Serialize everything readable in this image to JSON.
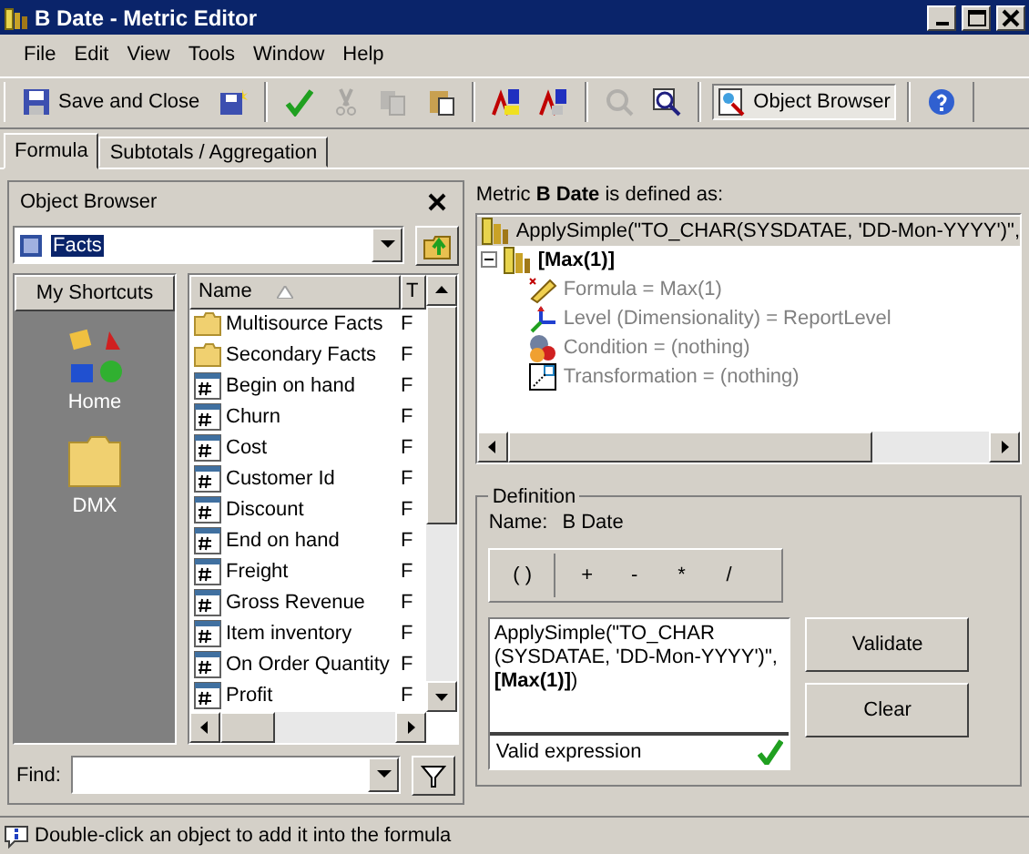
{
  "window": {
    "title": "B Date - Metric Editor"
  },
  "menu": [
    "File",
    "Edit",
    "View",
    "Tools",
    "Window",
    "Help"
  ],
  "toolbar": [
    [
      {
        "label": "Save and Close",
        "disabled": false
      },
      {
        "disabled": false
      }
    ],
    [
      {
        "disabled": false
      },
      {
        "disabled": true
      },
      {
        "disabled": true
      },
      {
        "disabled": false
      }
    ],
    [
      {
        "disabled": false
      },
      {
        "disabled": false
      }
    ],
    [
      {
        "disabled": true
      },
      {
        "disabled": false
      }
    ],
    [
      {
        "label": "Object Browser",
        "disabled": false,
        "pressed": true
      }
    ],
    [
      {
        "disabled": false
      }
    ]
  ],
  "tabs": [
    {
      "label": "Formula",
      "selected": true
    },
    {
      "label": "Subtotals / Aggregation",
      "selected": false
    }
  ],
  "object_browser": {
    "title": "Object Browser",
    "folder": "Facts",
    "shortcuts": {
      "header": "My Shortcuts",
      "items": [
        {
          "kind": "home",
          "label": "Home"
        },
        {
          "kind": "folder",
          "label": "DMX"
        }
      ]
    },
    "columns": [
      "Name",
      "T"
    ],
    "rows": [
      {
        "kind": "folder",
        "name": "Multisource Facts",
        "type": "F"
      },
      {
        "kind": "folder",
        "name": "Secondary Facts",
        "type": "F"
      },
      {
        "kind": "fact",
        "name": "Begin on hand",
        "type": "F"
      },
      {
        "kind": "fact",
        "name": "Churn",
        "type": "F"
      },
      {
        "kind": "fact",
        "name": "Cost",
        "type": "F"
      },
      {
        "kind": "fact",
        "name": "Customer Id",
        "type": "F"
      },
      {
        "kind": "fact",
        "name": "Discount",
        "type": "F"
      },
      {
        "kind": "fact",
        "name": "End on hand",
        "type": "F"
      },
      {
        "kind": "fact",
        "name": "Freight",
        "type": "F"
      },
      {
        "kind": "fact",
        "name": "Gross Revenue",
        "type": "F"
      },
      {
        "kind": "fact",
        "name": "Item inventory",
        "type": "F"
      },
      {
        "kind": "fact",
        "name": "On Order Quantity",
        "type": "F"
      },
      {
        "kind": "fact",
        "name": "Profit",
        "type": "F"
      }
    ],
    "find_label": "Find:"
  },
  "metric": {
    "heading": "Metric **B Date** is defined as:",
    "tree": [
      {
        "kind": "metric",
        "text": "ApplySimple(\"TO_CHAR(SYSDATAE, 'DD-Mon-YYYY')\",",
        "selected": true,
        "disabled": false
      },
      {
        "kind": "metric",
        "text": "[Max(1)]",
        "selected": false,
        "disabled": false,
        "expanded": true,
        "children": [
          {
            "kind": "formula",
            "text": "Formula = Max(1)",
            "selected": false,
            "disabled": true
          },
          {
            "kind": "level",
            "text": "Level (Dimensionality) = ReportLevel",
            "selected": false,
            "disabled": true
          },
          {
            "kind": "condition",
            "text": "Condition = (nothing)",
            "selected": false,
            "disabled": true
          },
          {
            "kind": "transformation",
            "text": "Transformation = (nothing)",
            "selected": false,
            "disabled": true
          }
        ]
      }
    ]
  },
  "definition": {
    "legend": "Definition",
    "name_label": "Name:",
    "name": "B Date",
    "operators": [
      "( )",
      "+",
      "-",
      "*",
      "/"
    ],
    "formula": "ApplySimple(\"TO_CHAR (SYSDATAE, 'DD-Mon-YYYY')\", **[Max(1)]**)",
    "status": "Valid expression",
    "valid": true,
    "buttons": [
      "Validate",
      "Clear"
    ]
  },
  "status_bar": "Double-click an object to add it into the formula"
}
